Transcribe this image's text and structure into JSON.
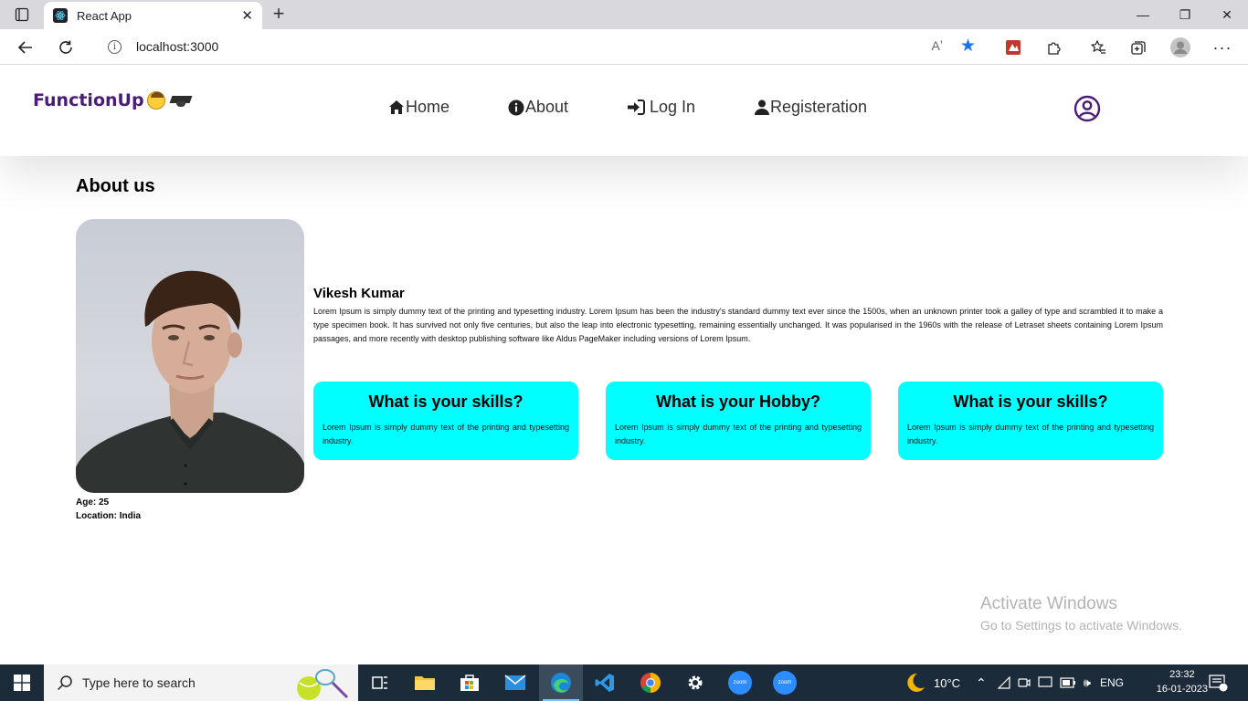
{
  "browser": {
    "tab_title": "React App",
    "url": "localhost:3000",
    "read_aloud": "Aʼ"
  },
  "navbar": {
    "brand": "FunctionUp",
    "items": [
      {
        "label": "Home",
        "icon": "home-icon"
      },
      {
        "label": "About",
        "icon": "info-icon"
      },
      {
        "label": "Log In",
        "icon": "sign-in-icon"
      },
      {
        "label": "Registeration",
        "icon": "user-icon"
      }
    ]
  },
  "about": {
    "title": "About us",
    "name": "Vikesh Kumar",
    "bio": "Lorem Ipsum is simply dummy text of the printing and typesetting industry. Lorem Ipsum has been the industry's standard dummy text ever since the 1500s, when an unknown printer took a galley of type and scrambled it to make a type specimen book. It has survived not only five centuries, but also the leap into electronic typesetting, remaining essentially unchanged. It was popularised in the 1960s with the release of Letraset sheets containing Lorem Ipsum passages, and more recently with desktop publishing software like Aldus PageMaker including versions of Lorem Ipsum.",
    "age": "Age: 25",
    "location": "Location: India",
    "cards": [
      {
        "title": "What is your skills?",
        "text": "Lorem Ipsum is simply dummy text of the printing and typesetting industry."
      },
      {
        "title": "What is your Hobby?",
        "text": "Lorem Ipsum is simply dummy text of the printing and typesetting industry."
      },
      {
        "title": "What is your skills?",
        "text": "Lorem Ipsum is simply dummy text of the printing and typesetting industry."
      }
    ]
  },
  "watermark": {
    "line1": "Activate Windows",
    "line2": "Go to Settings to activate Windows."
  },
  "taskbar": {
    "search_placeholder": "Type here to search",
    "weather": "10°C",
    "language": "ENG",
    "time": "23:32",
    "date": "16-01-2023",
    "notification_count": "1",
    "zoom_label": "zoom"
  },
  "colors": {
    "brand": "#4b1b7a",
    "card_bg": "#00ffff",
    "profile_icon": "#4b1b7a",
    "taskbar_bg": "#1c2b3a"
  }
}
